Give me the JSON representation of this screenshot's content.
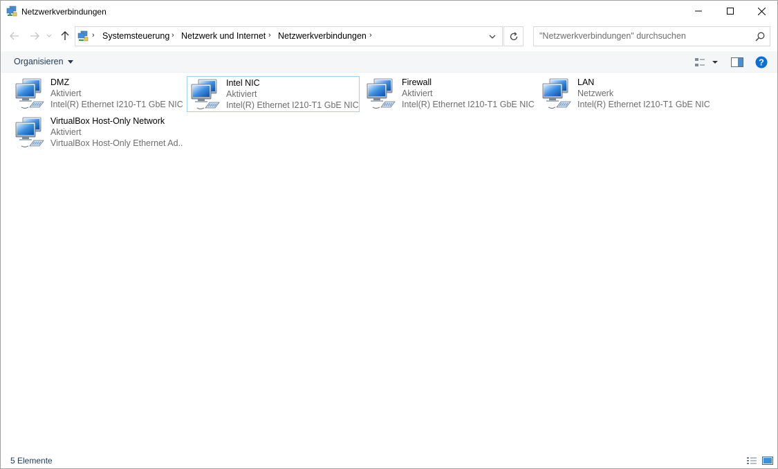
{
  "window": {
    "title": "Netzwerkverbindungen",
    "icons": {
      "app": "network-connections-icon",
      "minimize": "minimize-icon",
      "maximize": "maximize-icon",
      "close": "close-icon"
    }
  },
  "navigation": {
    "icons": [
      "back-arrow-icon",
      "forward-arrow-icon",
      "recent-locations-icon",
      "up-arrow-icon"
    ],
    "breadcrumb": [
      "Systemsteuerung",
      "Netzwerk und Internet",
      "Netzwerkverbindungen"
    ],
    "refresh_icon": "refresh-icon",
    "search": {
      "placeholder": "\"Netzwerkverbindungen\" durchsuchen",
      "icon": "search-icon"
    }
  },
  "toolbar": {
    "organize_label": "Organisieren",
    "icons": [
      "change-view-icon",
      "preview-pane-icon",
      "help-icon"
    ]
  },
  "connections": [
    {
      "name": "DMZ",
      "status": "Aktiviert",
      "device": "Intel(R) Ethernet I210-T1 GbE NIC ...",
      "selected": false,
      "icon": "network-adapter-icon"
    },
    {
      "name": "Intel NIC",
      "status": "Aktiviert",
      "device": "Intel(R) Ethernet I210-T1 GbE NIC",
      "selected": true,
      "icon": "network-adapter-icon"
    },
    {
      "name": "Firewall",
      "status": "Aktiviert",
      "device": "Intel(R) Ethernet I210-T1 GbE NIC ...",
      "selected": false,
      "icon": "network-adapter-icon"
    },
    {
      "name": "LAN",
      "status": "Netzwerk",
      "device": "Intel(R) Ethernet I210-T1 GbE NIC ...",
      "selected": false,
      "icon": "network-adapter-icon"
    },
    {
      "name": "VirtualBox Host-Only Network",
      "status": "Aktiviert",
      "device": "VirtualBox Host-Only Ethernet Ad...",
      "selected": false,
      "icon": "network-adapter-icon"
    }
  ],
  "statusbar": {
    "count_label": "5 Elemente",
    "icons": [
      "details-view-icon",
      "large-icons-view-icon"
    ]
  },
  "colors": {
    "accent": "#0078d7",
    "selection_border": "#99d1ff",
    "secondary_text": "#6d6d6d",
    "link_text": "#1e395b"
  }
}
